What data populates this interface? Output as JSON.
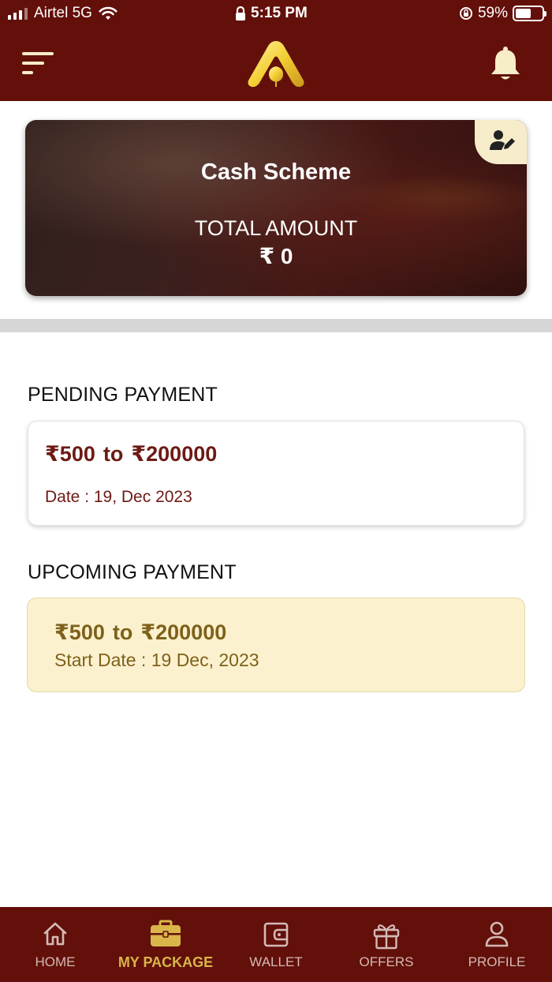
{
  "status_bar": {
    "carrier": "Airtel 5G",
    "time": "5:15 PM",
    "battery": "59%",
    "battery_fraction": 0.59
  },
  "header": {
    "menu_icon": "menu-icon",
    "logo_icon": "brand-logo",
    "bell_icon": "bell-icon"
  },
  "scheme": {
    "title": "Cash Scheme",
    "total_label": "TOTAL AMOUNT",
    "currency": "₹",
    "total_value": "0",
    "edit_icon": "user-edit-icon"
  },
  "pending": {
    "section_title": "PENDING PAYMENT",
    "from_amount": "500",
    "to_label": "to",
    "to_amount": "200000",
    "date": "Date : 19, Dec 2023"
  },
  "upcoming": {
    "section_title": "UPCOMING PAYMENT",
    "from_amount": "500",
    "to_label": "to",
    "to_amount": "200000",
    "start_date": "Start Date : 19  Dec, 2023"
  },
  "nav": {
    "items": [
      {
        "label": "HOME",
        "icon": "home-icon"
      },
      {
        "label": "MY PACKAGE",
        "icon": "briefcase-icon",
        "active": true
      },
      {
        "label": "WALLET",
        "icon": "wallet-icon"
      },
      {
        "label": "OFFERS",
        "icon": "gift-icon"
      },
      {
        "label": "PROFILE",
        "icon": "user-icon"
      }
    ]
  },
  "colors": {
    "brand": "#63100a",
    "accent": "#d9b54a",
    "cream": "#fbf1cf"
  }
}
